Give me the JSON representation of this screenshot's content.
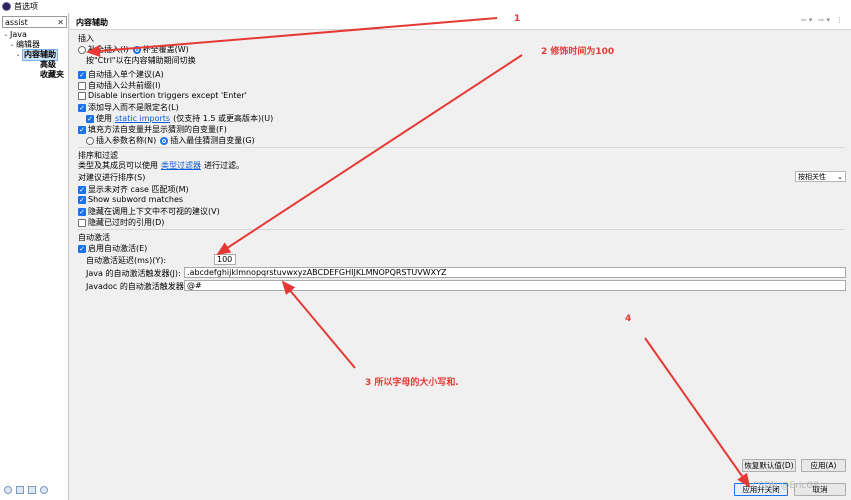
{
  "window": {
    "title": "首选项"
  },
  "sidebar": {
    "filter_value": "assist",
    "tree": [
      {
        "label": "Java",
        "expanded": true
      },
      {
        "label": "编辑器",
        "expanded": true
      },
      {
        "label": "内容辅助",
        "expanded": true,
        "selected": true
      },
      {
        "label": "高级"
      },
      {
        "label": "收藏夹"
      }
    ]
  },
  "page": {
    "title": "内容辅助",
    "insert": {
      "heading": "插入",
      "complete_insert_label": "补全插入(I)",
      "complete_overwrite_label": "补全覆盖(W)",
      "ctrl_hint": "按\"Ctrl\"以在内容辅助期间切换",
      "auto_insert_single": "自动插入单个建议(A)",
      "auto_insert_common_prefix": "自动插入公共前缀(I)",
      "disable_insertion_triggers": "Disable insertion triggers except 'Enter'",
      "add_import": "添加导入而不是限定名(L)",
      "use_label": "使用",
      "static_imports_link": "static imports",
      "static_imports_note": "(仅支持 1.5 或更高版本)(U)",
      "fill_method_args": "填充方法自变量并显示猜测的自变量(F)",
      "insert_param_names": "插入参数名称(N)",
      "insert_best_guess": "插入最佳猜测自变量(G)"
    },
    "sort_filter": {
      "heading": "排序和过滤",
      "type_filter_prefix": "类型及其成员可以使用",
      "type_filter_link": "类型过滤器",
      "type_filter_suffix": "进行过滤。",
      "sort_label": "对建议进行排序(S)",
      "sort_value": "按相关性",
      "show_camel_case": "显示未对齐 case 匹配项(M)",
      "show_subword": "Show subword matches",
      "hide_not_visible": "隐藏在调用上下文中不可视的建议(V)",
      "hide_deprecated": "隐藏已过时的引用(D)"
    },
    "auto_activation": {
      "heading": "自动激活",
      "enable_label": "启用自动激活(E)",
      "delay_label": "自动激活延迟(ms)(Y):",
      "delay_value": "100",
      "java_triggers_label": "Java 的自动激活触发器(J):",
      "java_triggers_value": ".abcdefghijklmnopqrstuvwxyzABCDEFGHIJKLMNOPQRSTUVWXYZ",
      "javadoc_triggers_label": "Javadoc 的自动激活触发器(O):",
      "javadoc_triggers_value": "@#"
    },
    "buttons": {
      "restore_defaults": "恢复默认值(D)",
      "apply": "应用(A)",
      "apply_close": "应用并关闭",
      "cancel": "取消"
    }
  },
  "annotations": {
    "a1": "1",
    "a2": "2 修饰时间为100",
    "a3": "3 所以字母的大小写和.",
    "a4": "4",
    "color": "#e53935"
  },
  "watermark": "CSDN @EricGP",
  "colors": {
    "accent": "#1a73e8",
    "annotation": "#e53935"
  }
}
